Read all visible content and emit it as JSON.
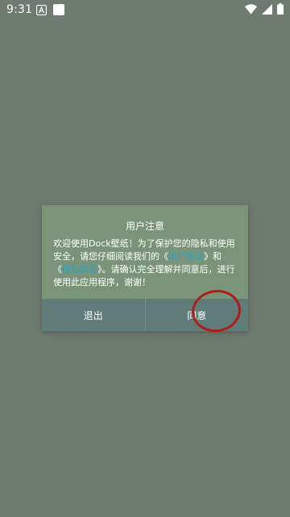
{
  "status_bar": {
    "time": "9:31",
    "left_icons": [
      "app-notification-icon",
      "image-notification-icon"
    ],
    "right_icons": [
      "wifi-icon",
      "signal-icon",
      "battery-icon"
    ]
  },
  "dialog": {
    "title": "用户注意",
    "message": {
      "part1": "欢迎使用Dock壁纸！为了保护您的隐私和使用安全，请您仔细阅读我们的《",
      "link1": "用户协议",
      "part2": "》和《",
      "link2": "隐私政策",
      "part3": "》。请确认完全理解并同意后，进行使用此应用程序，谢谢！"
    },
    "buttons": {
      "exit_label": "退出",
      "agree_label": "同意"
    }
  },
  "colors": {
    "background": "#6f7a70",
    "dialog": "#7a9479",
    "buttons_bar": "#5f7c79",
    "link": "#27a4c2",
    "highlight_circle": "#b01c1c"
  }
}
